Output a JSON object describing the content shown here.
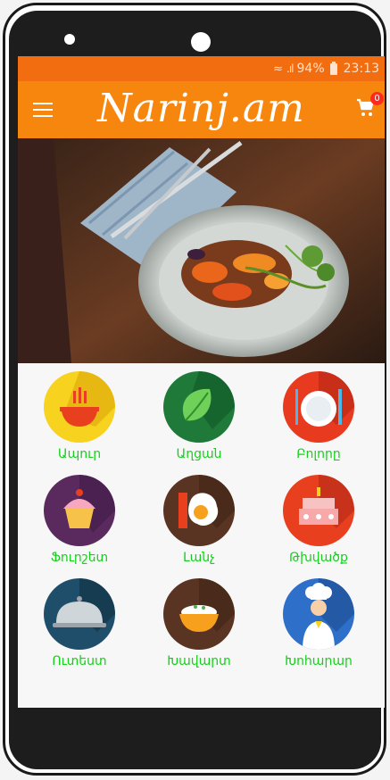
{
  "status": {
    "battery": "94%",
    "time": "23:13"
  },
  "app": {
    "title": "Narinj.am",
    "cart_count": "0"
  },
  "colors": {
    "statusbar": "#f26d0f",
    "appbar": "#f7860f",
    "label": "#14d11b"
  },
  "categories": [
    {
      "label": "Ապուր",
      "icon": "soup-bowl-icon"
    },
    {
      "label": "Աղցան",
      "icon": "salad-leaf-icon"
    },
    {
      "label": "Բոլորը",
      "icon": "plate-cutlery-icon"
    },
    {
      "label": "Ֆուրշետ",
      "icon": "cupcake-icon"
    },
    {
      "label": "Լանչ",
      "icon": "egg-bacon-icon"
    },
    {
      "label": "Թխվածք",
      "icon": "cake-icon"
    },
    {
      "label": "Ուտեստ",
      "icon": "cloche-icon"
    },
    {
      "label": "Խավարտ",
      "icon": "rice-bowl-icon"
    },
    {
      "label": "Խոհարար",
      "icon": "chef-icon"
    }
  ]
}
